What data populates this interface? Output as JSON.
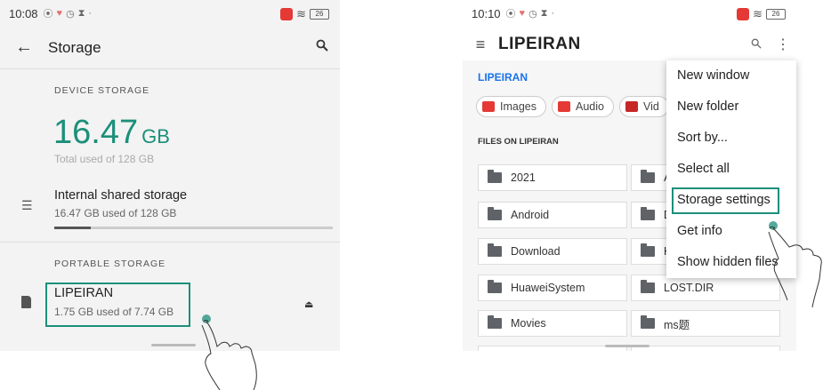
{
  "left_screen": {
    "status": {
      "time": "10:08",
      "battery": "26"
    },
    "toolbar": {
      "title": "Storage"
    },
    "device_storage": {
      "header": "DEVICE STORAGE",
      "used_number": "16.47",
      "used_unit": "GB",
      "subtitle": "Total used of 128 GB"
    },
    "internal": {
      "title": "Internal shared storage",
      "subtitle": "16.47 GB used of 128 GB",
      "progress": 0.13
    },
    "portable": {
      "header": "PORTABLE STORAGE",
      "title": "LIPEIRAN",
      "subtitle": "1.75 GB used of 7.74 GB"
    }
  },
  "right_screen": {
    "status": {
      "time": "10:10",
      "battery": "26"
    },
    "toolbar": {
      "title": "LIPEIRAN"
    },
    "breadcrumb": "LIPEIRAN",
    "chips": [
      {
        "label": "Images",
        "color": "#e53935"
      },
      {
        "label": "Audio",
        "color": "#e53935"
      },
      {
        "label": "Vid",
        "color": "#c62828"
      }
    ],
    "files_header": "FILES ON LIPEIRAN",
    "folders_left": [
      "2021",
      "Android",
      "Download",
      "HuaweiSystem",
      "Movies"
    ],
    "folders_right": [
      "A",
      "D",
      "H",
      "LOST.DIR",
      "ms题"
    ],
    "menu": [
      "New window",
      "New folder",
      "Sort by...",
      "Select all",
      "Storage settings",
      "Get info",
      "Show hidden files"
    ]
  },
  "colors": {
    "accent": "#1c8f7a",
    "link": "#1a73e8"
  }
}
